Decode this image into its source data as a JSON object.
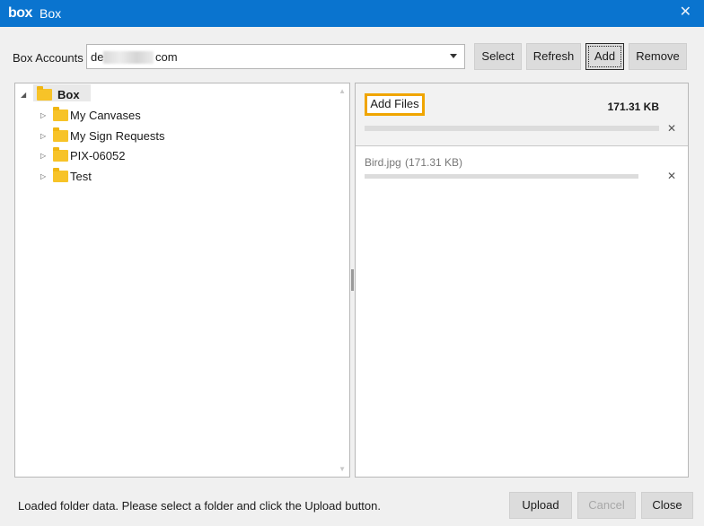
{
  "window": {
    "logo": "box",
    "title": "Box"
  },
  "accounts": {
    "label": "Box Accounts",
    "value_prefix": "de",
    "value_suffix": "com"
  },
  "toolbar": {
    "select": "Select",
    "refresh": "Refresh",
    "add": "Add",
    "remove": "Remove"
  },
  "tree": {
    "root": "Box",
    "items": [
      "My Canvases",
      "My Sign Requests",
      "PIX-06052",
      "Test"
    ]
  },
  "upload_panel": {
    "add_files_label": "Add Files",
    "total_size": "171.31 KB",
    "files": [
      {
        "name": "Bird.jpg",
        "size": "(171.31 KB)"
      }
    ]
  },
  "status": "Loaded folder data. Please select a folder and click the Upload button.",
  "footer": {
    "upload": "Upload",
    "cancel": "Cancel",
    "close": "Close"
  },
  "colors": {
    "titlebar": "#0a74cf",
    "highlight": "#f0a500",
    "folder": "#f7c328"
  }
}
